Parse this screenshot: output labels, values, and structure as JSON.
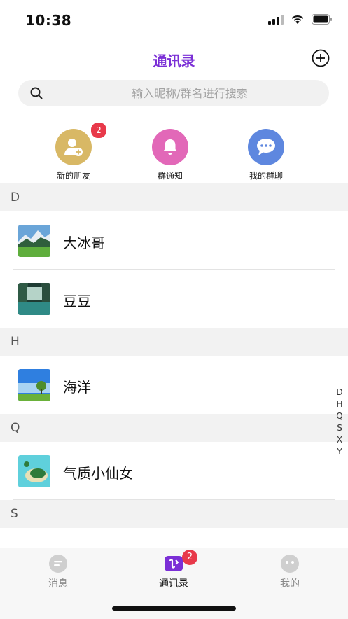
{
  "status_bar": {
    "time": "10:38"
  },
  "header": {
    "title": "通讯录",
    "add_icon": "plus-circle-icon"
  },
  "search": {
    "placeholder": "输入昵称/群名进行搜索",
    "value": ""
  },
  "quick_actions": [
    {
      "label": "新的朋友",
      "icon": "add-user-icon",
      "color": "#d8b865",
      "badge": "2"
    },
    {
      "label": "群通知",
      "icon": "bell-icon",
      "color": "#e268b8"
    },
    {
      "label": "我的群聊",
      "icon": "chat-bubbles-icon",
      "color": "#5e87df"
    }
  ],
  "contacts": {
    "sections": [
      {
        "letter": "D",
        "items": [
          {
            "name": "大冰哥"
          },
          {
            "name": "豆豆"
          }
        ]
      },
      {
        "letter": "H",
        "items": [
          {
            "name": "海洋"
          }
        ]
      },
      {
        "letter": "Q",
        "items": [
          {
            "name": "气质小仙女"
          }
        ]
      },
      {
        "letter": "S",
        "items": []
      }
    ]
  },
  "index_letters": [
    "D",
    "H",
    "Q",
    "S",
    "X",
    "Y"
  ],
  "tabbar": {
    "tabs": [
      {
        "label": "消息",
        "icon": "message-icon"
      },
      {
        "label": "通讯录",
        "icon": "contacts-icon",
        "badge": "2",
        "active": true
      },
      {
        "label": "我的",
        "icon": "profile-face-icon"
      }
    ]
  },
  "colors": {
    "accent": "#7b2fd6",
    "badge": "#e8394a"
  }
}
